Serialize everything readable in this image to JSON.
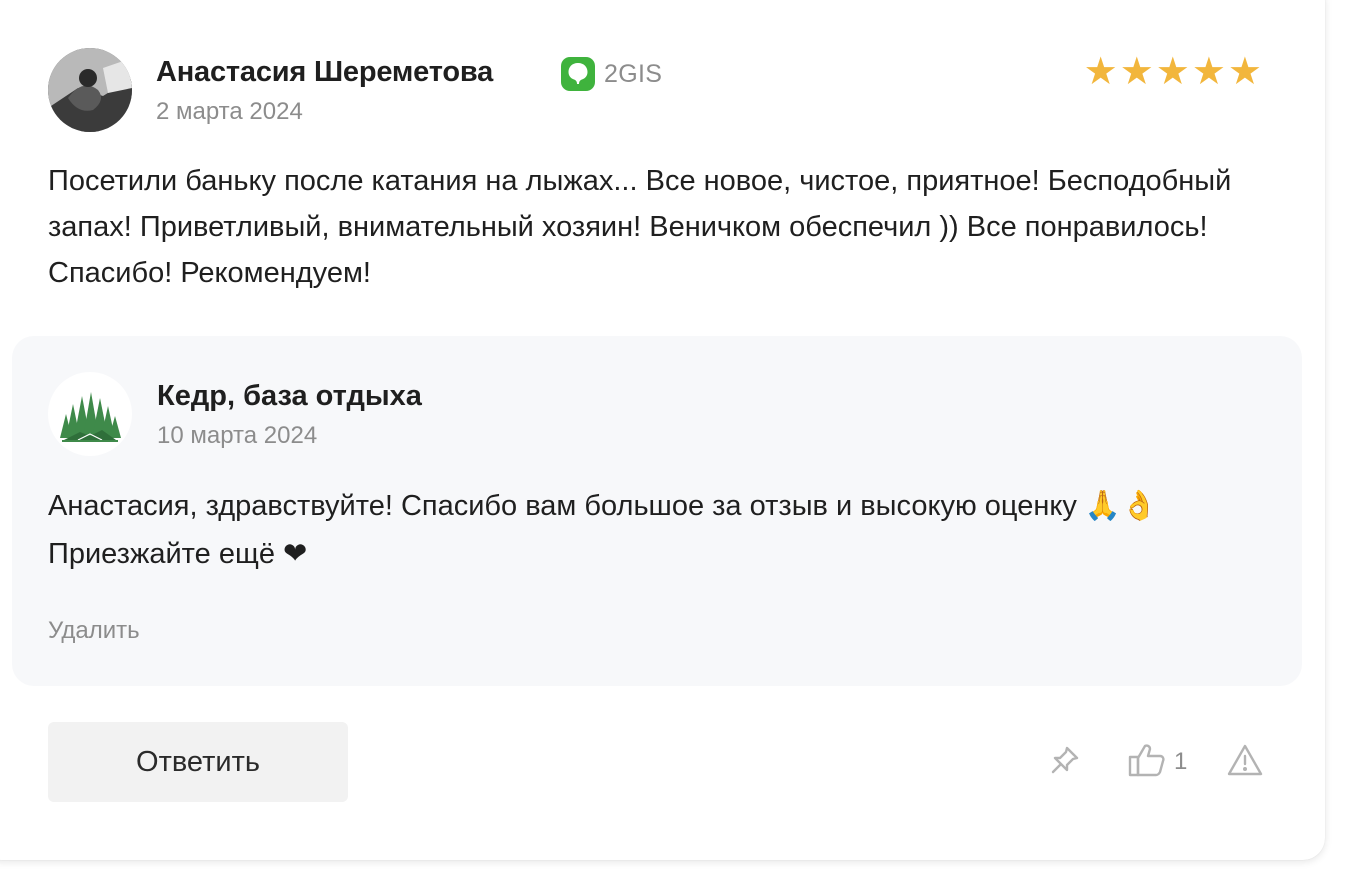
{
  "review": {
    "author": "Анастасия Шереметова",
    "source": "2GIS",
    "date": "2 марта 2024",
    "rating": 5,
    "stars": [
      "★",
      "★",
      "★",
      "★",
      "★"
    ],
    "text": "Посетили баньку после катания на лыжах... Все новое, чистое, приятное! Бесподобный запах! Приветливый, внимательный хозяин! Веничком обеспечил )) Все понравилось! Спасибо! Рекомендуем!"
  },
  "reply": {
    "company": "Кедр, база отдыха",
    "date": "10 марта 2024",
    "text": "Анастасия, здравствуйте! Спасибо вам большое за отзыв и высокую оценку 🙏👌 Приезжайте ещё ❤",
    "delete_label": "Удалить"
  },
  "actions": {
    "reply_button": "Ответить",
    "likes": "1",
    "icons": [
      "pin-icon",
      "thumbs-up-icon",
      "warning-icon"
    ]
  },
  "colors": {
    "star": "#f2b63c",
    "source_badge": "#3fb33d",
    "muted_text": "#8c8c8c",
    "reply_background": "#f7f8fa"
  }
}
